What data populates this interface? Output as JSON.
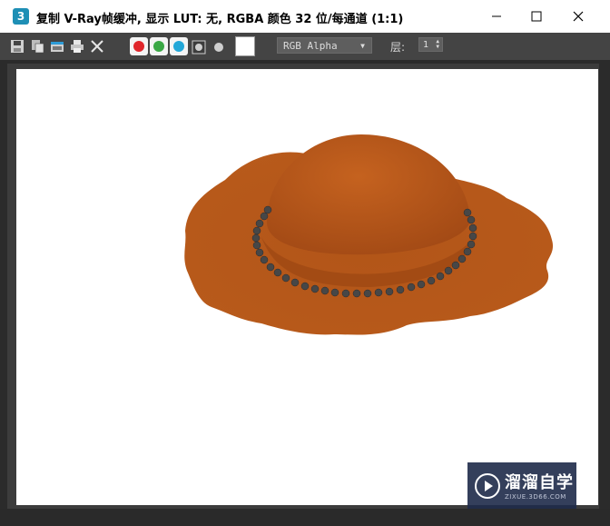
{
  "window": {
    "app_icon_text": "3",
    "title": "复制 V-Ray帧缓冲, 显示 LUT: 无, RGBA 颜色 32 位/每通道 (1:1)",
    "controls": [
      "minimize-icon",
      "maximize-icon",
      "close-icon"
    ]
  },
  "toolbar": {
    "icons": [
      "save-icon",
      "copy-icon",
      "clone-icon",
      "print-icon",
      "clear-icon"
    ],
    "channels": [
      {
        "name": "red",
        "color": "#e0262b"
      },
      {
        "name": "green",
        "color": "#3aa845"
      },
      {
        "name": "blue",
        "color": "#22a7d8"
      }
    ],
    "channel_select": "RGB Alpha",
    "layer_label": "层:",
    "layer_value": "1"
  },
  "watermark": {
    "text": "溜溜自学",
    "subtext": "ZIXUE.3D66.COM"
  },
  "colors": {
    "hat": "#b4561a",
    "beads": "#3a3a3a",
    "toolbar_bg": "#444444",
    "canvas_bg": "#ffffff"
  }
}
